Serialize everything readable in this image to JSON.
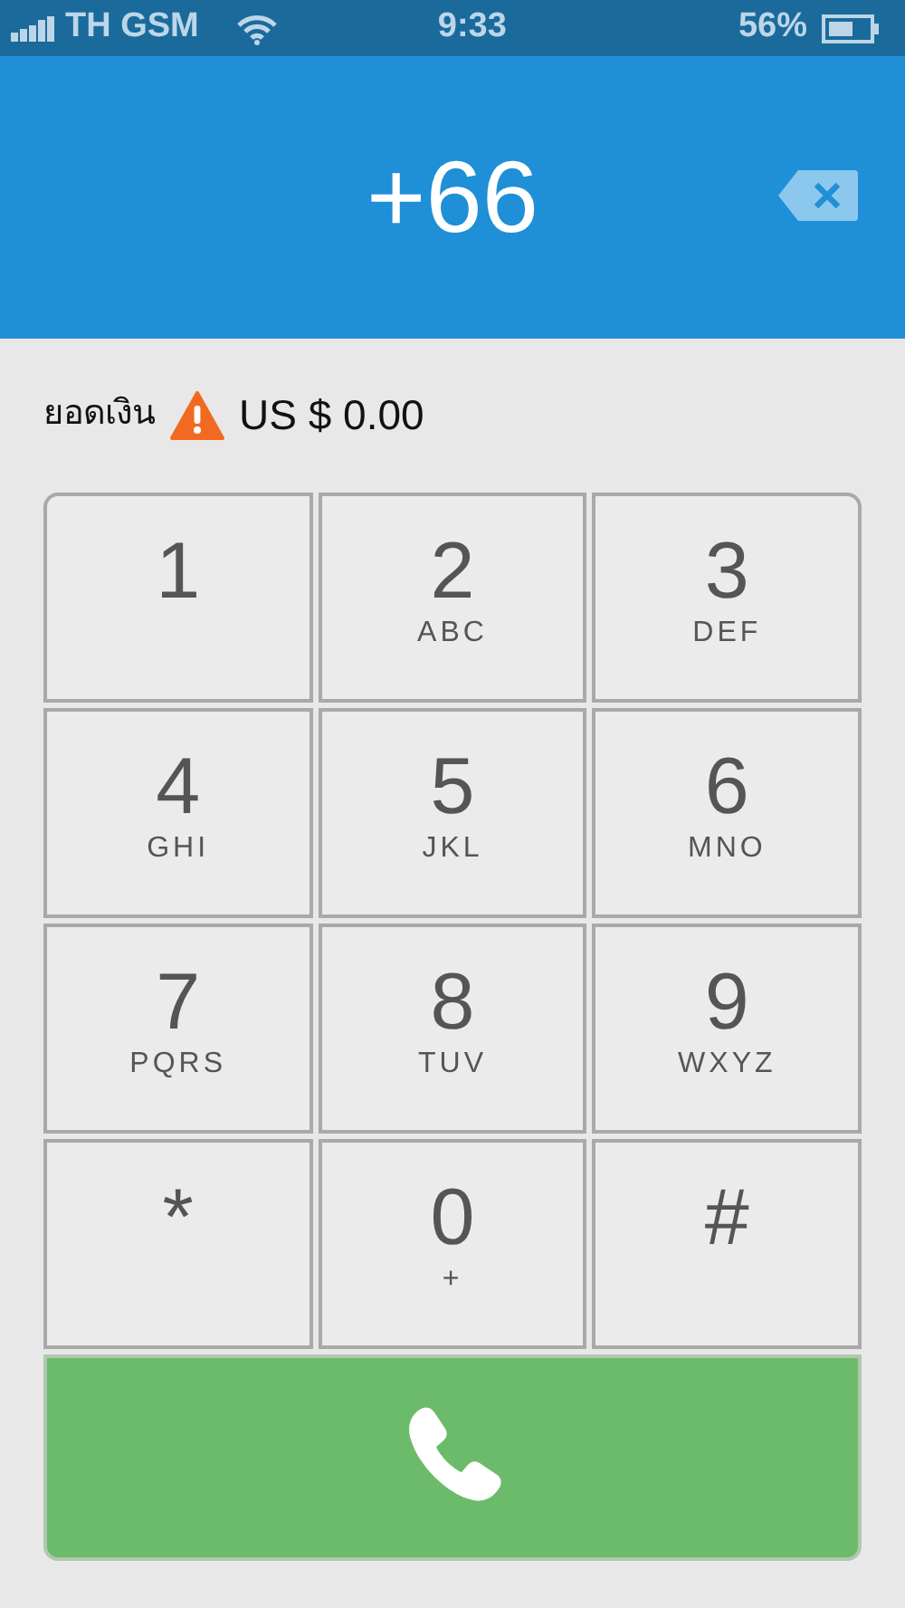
{
  "status_bar": {
    "carrier": "TH GSM",
    "time": "9:33",
    "battery": "56%"
  },
  "display": {
    "number": "+66"
  },
  "balance": {
    "label": "ยอดเงิน",
    "amount": "US $ 0.00"
  },
  "keypad": [
    {
      "digit": "1"
    },
    {
      "digit": "2",
      "letters": "ABC"
    },
    {
      "digit": "3",
      "letters": "DEF"
    },
    {
      "digit": "4",
      "letters": "GHI"
    },
    {
      "digit": "5",
      "letters": "JKL"
    },
    {
      "digit": "6",
      "letters": "MNO"
    },
    {
      "digit": "7",
      "letters": "PQRS"
    },
    {
      "digit": "8",
      "letters": "TUV"
    },
    {
      "digit": "9",
      "letters": "WXYZ"
    },
    {
      "digit": "*"
    },
    {
      "digit": "0",
      "letters": "+"
    },
    {
      "digit": "#"
    }
  ]
}
